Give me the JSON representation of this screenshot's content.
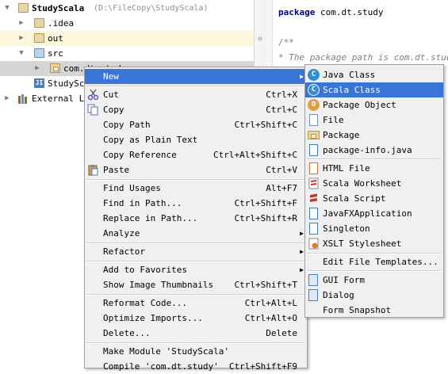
{
  "tree": {
    "project_name": "StudyScala",
    "project_path": "(D:\\FileCopy\\StudyScala)",
    "items": [
      {
        "label": ".idea"
      },
      {
        "label": "out"
      },
      {
        "label": "src"
      },
      {
        "label": "com.dt.study"
      },
      {
        "label": "StudyScala.iml"
      },
      {
        "label": "External Libraries"
      }
    ]
  },
  "editor": {
    "line1_keyword": "package",
    "line1_rest": " com.dt.study",
    "line2": "/**",
    "line3": " * The package path is com.dt.study."
  },
  "context_menu": {
    "new": "New",
    "cut": "Cut",
    "cut_sc": "Ctrl+X",
    "copy": "Copy",
    "copy_sc": "Ctrl+C",
    "copy_path": "Copy Path",
    "copy_path_sc": "Ctrl+Shift+C",
    "copy_plain": "Copy as Plain Text",
    "copy_ref": "Copy Reference",
    "copy_ref_sc": "Ctrl+Alt+Shift+C",
    "paste": "Paste",
    "paste_sc": "Ctrl+V",
    "find_usages": "Find Usages",
    "find_usages_sc": "Alt+F7",
    "find_in_path": "Find in Path...",
    "find_in_path_sc": "Ctrl+Shift+F",
    "replace_in_path": "Replace in Path...",
    "replace_in_path_sc": "Ctrl+Shift+R",
    "analyze": "Analyze",
    "refactor": "Refactor",
    "add_favorites": "Add to Favorites",
    "show_thumbs": "Show Image Thumbnails",
    "show_thumbs_sc": "Ctrl+Shift+T",
    "reformat": "Reformat Code...",
    "reformat_sc": "Ctrl+Alt+L",
    "optimize": "Optimize Imports...",
    "optimize_sc": "Ctrl+Alt+O",
    "delete": "Delete...",
    "delete_sc": "Delete",
    "make_module": "Make Module 'StudyScala'",
    "compile": "Compile 'com.dt.study'",
    "compile_sc": "Ctrl+Shift+F9"
  },
  "submenu": {
    "java_class": "Java Class",
    "scala_class": "Scala Class",
    "package_object": "Package Object",
    "file": "File",
    "package": "Package",
    "package_info": "package-info.java",
    "html_file": "HTML File",
    "scala_worksheet": "Scala Worksheet",
    "scala_script": "Scala Script",
    "javafx_app": "JavaFXApplication",
    "singleton": "Singleton",
    "xslt": "XSLT Stylesheet",
    "edit_templates": "Edit File Templates...",
    "gui_form": "GUI Form",
    "dialog": "Dialog",
    "form_snapshot": "Form Snapshot"
  },
  "colors": {
    "highlight": "#3875d7",
    "menu_bg": "#f0f0f0",
    "scala_icon": "#c0392b",
    "java_icon": "#2f8fcf"
  }
}
